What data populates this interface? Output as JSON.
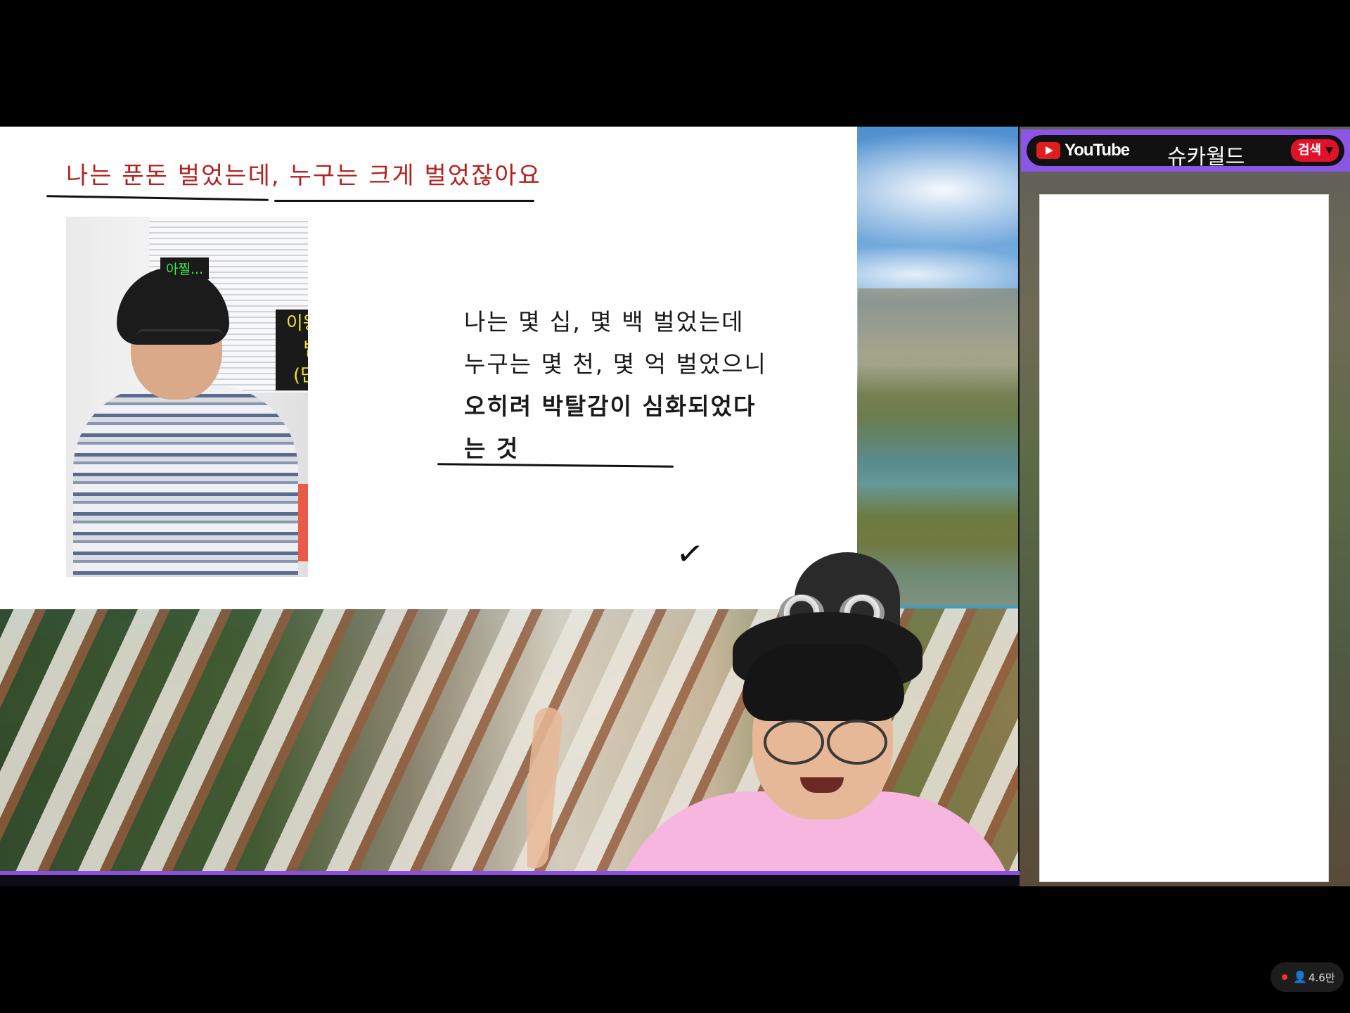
{
  "slide": {
    "heading": "나는 푼돈 벌었는데, 누구는 크게 벌었잖아요",
    "caption_small": "아찔...",
    "caption_yellow": [
      "이왕 이렇게 된 거",
      "법인자금으로",
      "(단타나 치시죠)"
    ],
    "body_lines": [
      {
        "text": "나는 몇 십, 몇 백 벌었는데",
        "bold": false
      },
      {
        "text": "누구는 몇 천, 몇 억 벌었으니",
        "bold": false
      },
      {
        "text": "오히려 박탈감이 심화되었다",
        "bold": true
      },
      {
        "text": "는 것",
        "bold": true
      }
    ]
  },
  "search_widget": {
    "brand": "YouTube",
    "query": "슈카월드",
    "button_label": "검색"
  },
  "viewer": {
    "count": "4.6만"
  },
  "colors": {
    "heading": "#b4221f",
    "accent": "#8c4fe0",
    "caption_green": "#3ee84a",
    "caption_yellow": "#f2e332"
  },
  "icons": [
    "youtube-logo-icon",
    "dropdown-arrow-icon",
    "live-dot-icon",
    "person-icon",
    "checkmark-icon"
  ]
}
